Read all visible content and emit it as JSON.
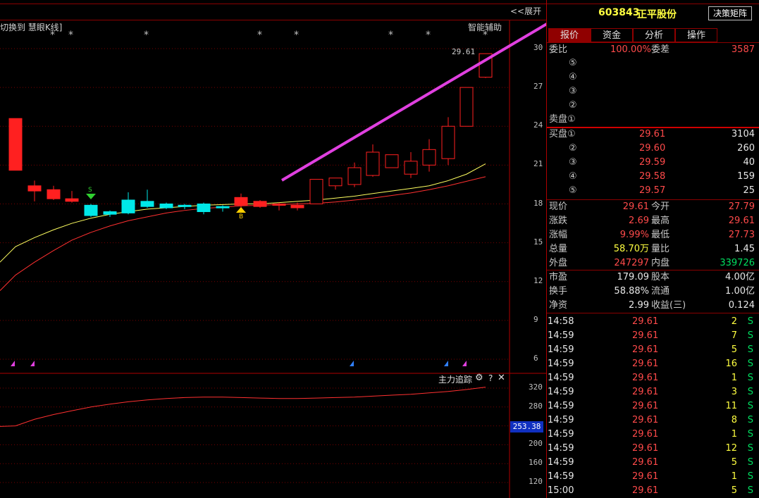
{
  "header": {
    "switch_label": "切换到 慧眼K线]",
    "expand_label": "<<展开",
    "assist_label": "智能辅助",
    "stock_code": "603843",
    "stock_name": "正平股份",
    "decision_button": "决策矩阵"
  },
  "tabs": [
    "报价",
    "资金",
    "分析",
    "操作"
  ],
  "chart": {
    "price_axis": [
      "30",
      "27",
      "24",
      "21",
      "18",
      "15",
      "12",
      "9",
      "6"
    ],
    "last_price_tag": "29.61",
    "indicator_axis": [
      "320",
      "280",
      "240",
      "200",
      "160",
      "120"
    ],
    "indicator_value": "253.38",
    "indicator_title": "主力追踪",
    "settings_icon": "gear-icon",
    "help_label": "?",
    "close_label": "✕",
    "star_char": "*",
    "buy_marker_text": "B",
    "sell_marker_text": "S",
    "colors": {
      "up": "#ff2020",
      "down": "#00e8e8",
      "ma_short": "#ffff60",
      "ma_long": "#ff3030",
      "trend_arrow": "#e040e0"
    }
  },
  "chart_data": {
    "type": "candlestick",
    "candles": [
      {
        "o": 24.6,
        "c": 20.6,
        "h": 24.6,
        "l": 20.6,
        "up": true
      },
      {
        "o": 19.4,
        "c": 19.0,
        "h": 19.8,
        "l": 18.2,
        "up": true
      },
      {
        "o": 19.1,
        "c": 18.4,
        "h": 19.4,
        "l": 18.3,
        "up": true
      },
      {
        "o": 18.4,
        "c": 18.2,
        "h": 19.0,
        "l": 18.1,
        "up": true
      },
      {
        "o": 17.9,
        "c": 17.1,
        "h": 18.0,
        "l": 17.0,
        "up": false
      },
      {
        "o": 17.4,
        "c": 17.2,
        "h": 17.5,
        "l": 17.0,
        "up": false
      },
      {
        "o": 18.3,
        "c": 17.3,
        "h": 18.9,
        "l": 17.2,
        "up": false
      },
      {
        "o": 18.2,
        "c": 17.8,
        "h": 19.1,
        "l": 17.7,
        "up": false
      },
      {
        "o": 18.0,
        "c": 17.7,
        "h": 18.1,
        "l": 17.6,
        "up": false
      },
      {
        "o": 17.9,
        "c": 17.8,
        "h": 18.0,
        "l": 17.6,
        "up": false
      },
      {
        "o": 18.0,
        "c": 17.4,
        "h": 18.1,
        "l": 17.2,
        "up": false
      },
      {
        "o": 17.8,
        "c": 17.7,
        "h": 17.9,
        "l": 17.4,
        "up": false
      },
      {
        "o": 17.9,
        "c": 18.5,
        "h": 18.8,
        "l": 17.6,
        "up": true
      },
      {
        "o": 17.8,
        "c": 18.2,
        "h": 18.3,
        "l": 17.7,
        "up": true
      },
      {
        "o": 17.9,
        "c": 18.0,
        "h": 18.1,
        "l": 17.5,
        "up": true
      },
      {
        "o": 17.7,
        "c": 17.9,
        "h": 18.1,
        "l": 17.5,
        "up": true
      },
      {
        "o": 18.0,
        "c": 19.9,
        "h": 19.9,
        "l": 18.0,
        "up": true
      },
      {
        "o": 19.4,
        "c": 20.0,
        "h": 20.0,
        "l": 19.1,
        "up": true
      },
      {
        "o": 19.5,
        "c": 20.8,
        "h": 21.2,
        "l": 19.3,
        "up": true
      },
      {
        "o": 20.2,
        "c": 22.0,
        "h": 22.6,
        "l": 20.1,
        "up": true
      },
      {
        "o": 20.8,
        "c": 21.8,
        "h": 21.8,
        "l": 20.8,
        "up": true
      },
      {
        "o": 20.3,
        "c": 21.3,
        "h": 22.0,
        "l": 20.0,
        "up": true
      },
      {
        "o": 21.0,
        "c": 22.2,
        "h": 23.0,
        "l": 20.5,
        "up": true
      },
      {
        "o": 21.5,
        "c": 24.0,
        "h": 24.7,
        "l": 21.0,
        "up": true
      },
      {
        "o": 24.0,
        "c": 27.0,
        "h": 27.0,
        "l": 24.0,
        "up": true
      },
      {
        "o": 27.79,
        "c": 29.61,
        "h": 29.61,
        "l": 27.73,
        "up": true
      }
    ],
    "ma_short": [
      14.7,
      15.4,
      16.0,
      16.5,
      16.9,
      17.2,
      17.4,
      17.6,
      17.7,
      17.8,
      17.9,
      17.95,
      18.0,
      18.0,
      18.1,
      18.2,
      18.3,
      18.45,
      18.6,
      18.8,
      19.0,
      19.2,
      19.4,
      19.8,
      20.3,
      21.1
    ],
    "ma_long": [
      12.5,
      13.5,
      14.4,
      15.2,
      15.8,
      16.3,
      16.7,
      17.0,
      17.3,
      17.5,
      17.65,
      17.75,
      17.85,
      17.9,
      17.95,
      18.0,
      18.05,
      18.15,
      18.3,
      18.45,
      18.65,
      18.85,
      19.1,
      19.4,
      19.75,
      20.1
    ],
    "indicator": [
      240,
      254,
      264,
      272,
      280,
      286,
      291,
      295,
      298,
      300,
      301,
      301,
      300,
      299,
      298,
      298,
      299,
      300,
      301,
      303,
      305,
      307,
      310,
      313,
      317,
      322
    ],
    "ylim": [
      6,
      30
    ],
    "indicator_ylim": [
      120,
      320
    ]
  },
  "quote": {
    "weibi_label": "委比",
    "weibi_value": "100.00%",
    "weicha_label": "委差",
    "weicha_value": "3587",
    "sell_levels": [
      {
        "label": "⑤",
        "price": "",
        "vol": ""
      },
      {
        "label": "④",
        "price": "",
        "vol": ""
      },
      {
        "label": "③",
        "price": "",
        "vol": ""
      },
      {
        "label": "②",
        "price": "",
        "vol": ""
      },
      {
        "label": "卖盘①",
        "price": "",
        "vol": ""
      }
    ],
    "buy_levels": [
      {
        "label": "买盘①",
        "price": "29.61",
        "vol": "3104"
      },
      {
        "label": "②",
        "price": "29.60",
        "vol": "260"
      },
      {
        "label": "③",
        "price": "29.59",
        "vol": "40"
      },
      {
        "label": "④",
        "price": "29.58",
        "vol": "159"
      },
      {
        "label": "⑤",
        "price": "29.57",
        "vol": "25"
      }
    ],
    "stats": [
      {
        "l1": "现价",
        "v1": "29.61",
        "c1": "red",
        "l2": "今开",
        "v2": "27.79",
        "c2": "red"
      },
      {
        "l1": "涨跌",
        "v1": "2.69",
        "c1": "red",
        "l2": "最高",
        "v2": "29.61",
        "c2": "red"
      },
      {
        "l1": "涨幅",
        "v1": "9.99%",
        "c1": "red",
        "l2": "最低",
        "v2": "27.73",
        "c2": "red"
      },
      {
        "l1": "总量",
        "v1": "58.70万",
        "c1": "yellow",
        "l2": "量比",
        "v2": "1.45",
        "c2": "white"
      },
      {
        "l1": "外盘",
        "v1": "247297",
        "c1": "red",
        "l2": "内盘",
        "v2": "339726",
        "c2": "green"
      }
    ],
    "fund": [
      {
        "l1": "市盈",
        "v1": "179.09",
        "l2": "股本",
        "v2": "4.00亿"
      },
      {
        "l1": "换手",
        "v1": "58.88%",
        "l2": "流通",
        "v2": "1.00亿"
      },
      {
        "l1": "净资",
        "v1": "2.99",
        "l2": "收益(三)",
        "v2": "0.124"
      }
    ],
    "ticks": [
      {
        "t": "14:58",
        "p": "29.61",
        "v": "2",
        "s": "S"
      },
      {
        "t": "14:59",
        "p": "29.61",
        "v": "7",
        "s": "S"
      },
      {
        "t": "14:59",
        "p": "29.61",
        "v": "5",
        "s": "S"
      },
      {
        "t": "14:59",
        "p": "29.61",
        "v": "16",
        "s": "S"
      },
      {
        "t": "14:59",
        "p": "29.61",
        "v": "1",
        "s": "S"
      },
      {
        "t": "14:59",
        "p": "29.61",
        "v": "3",
        "s": "S"
      },
      {
        "t": "14:59",
        "p": "29.61",
        "v": "11",
        "s": "S"
      },
      {
        "t": "14:59",
        "p": "29.61",
        "v": "8",
        "s": "S"
      },
      {
        "t": "14:59",
        "p": "29.61",
        "v": "1",
        "s": "S"
      },
      {
        "t": "14:59",
        "p": "29.61",
        "v": "12",
        "s": "S"
      },
      {
        "t": "14:59",
        "p": "29.61",
        "v": "5",
        "s": "S"
      },
      {
        "t": "14:59",
        "p": "29.61",
        "v": "1",
        "s": "S"
      },
      {
        "t": "15:00",
        "p": "29.61",
        "v": "5",
        "s": "S"
      }
    ]
  }
}
